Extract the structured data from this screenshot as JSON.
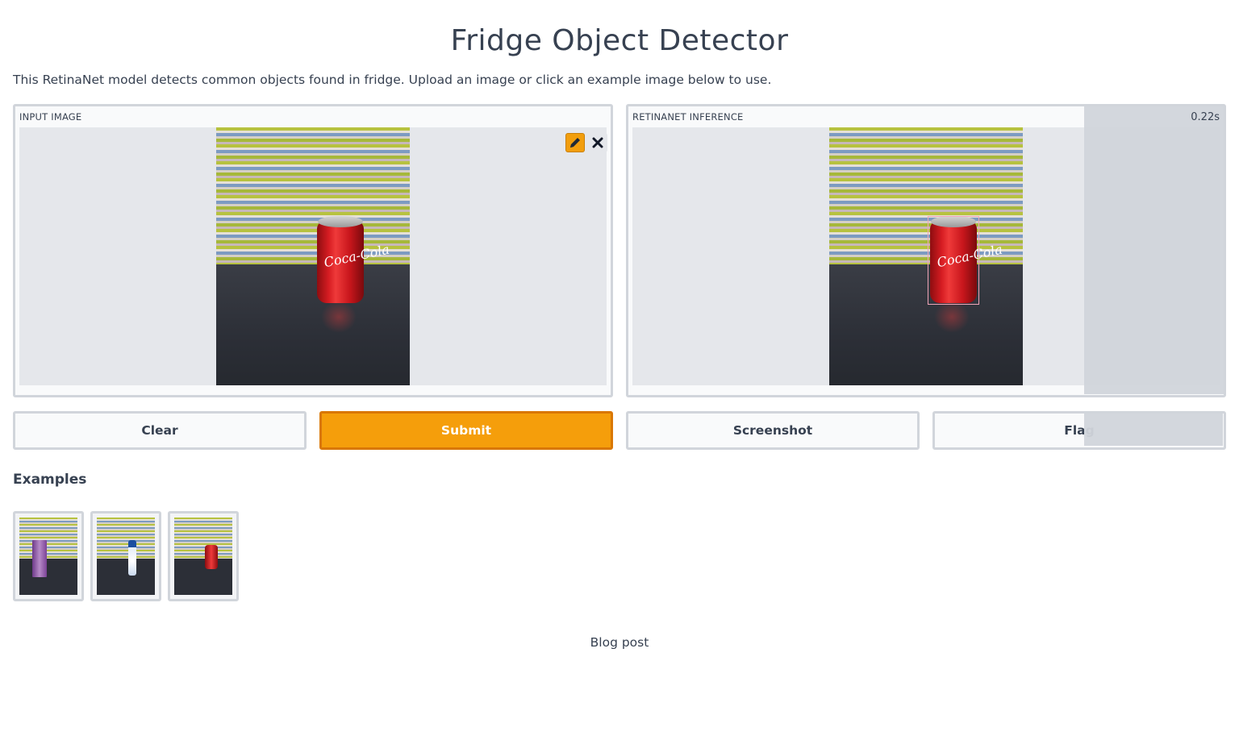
{
  "header": {
    "title": "Fridge Object Detector",
    "description": "This RetinaNet model detects common objects found in fridge. Upload an image or click an example image below to use."
  },
  "input_panel": {
    "label": "INPUT IMAGE",
    "image_text": "Coca-Cola",
    "edit_icon": "pencil-icon",
    "close_icon": "close-icon"
  },
  "output_panel": {
    "label": "RETINANET INFERENCE",
    "image_text": "Coca-Cola",
    "timer": "0.22s"
  },
  "buttons": {
    "clear": "Clear",
    "submit": "Submit",
    "screenshot": "Screenshot",
    "flag": "Flag"
  },
  "examples": {
    "title": "Examples",
    "items": [
      "milk carton",
      "water bottle",
      "coke can"
    ]
  },
  "footer": {
    "link": "Blog post"
  },
  "colors": {
    "accent": "#f59e0b",
    "text": "#374151",
    "border": "#d1d5db"
  }
}
